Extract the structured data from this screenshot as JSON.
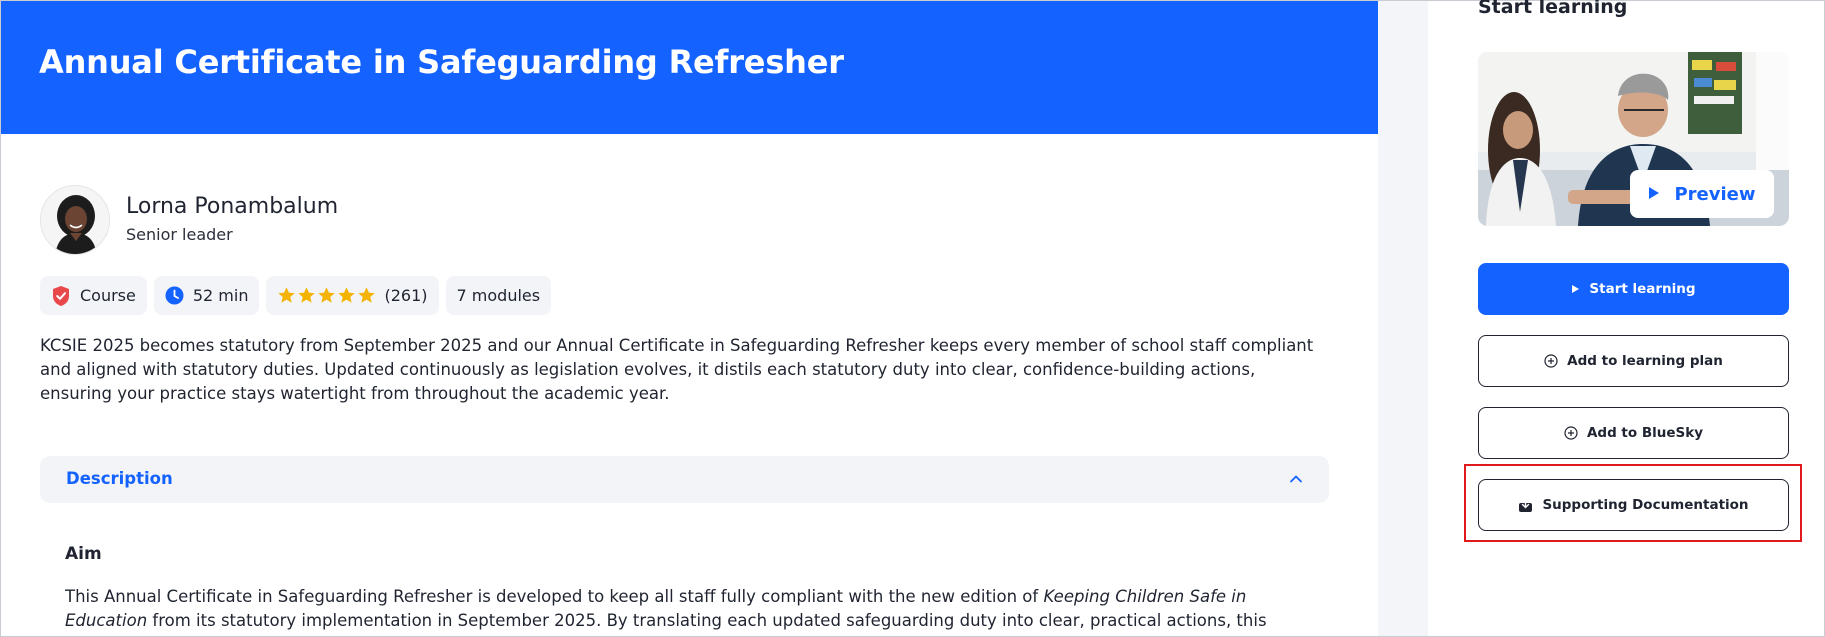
{
  "course": {
    "title": "Annual Certificate in Safeguarding Refresher",
    "author_name": "Lorna Ponambalum",
    "author_role": "Senior leader",
    "chips": {
      "type_label": "Course",
      "duration": "52 min",
      "rating_count": "(261)",
      "rating_stars": 5,
      "modules": "7 modules"
    },
    "summary": "KCSIE 2025 becomes statutory from September 2025 and our Annual Certificate in Safeguarding Refresher keeps every member of school staff compliant and aligned with statutory duties. Updated continuously as legislation evolves, it distils each statutory duty into clear, confidence-building actions, ensuring your practice stays watertight from throughout the academic year."
  },
  "description": {
    "heading": "Description",
    "aim_heading": "Aim",
    "aim_text_before": "This Annual Certificate in Safeguarding Refresher is developed to keep all staff fully compliant with the new edition of ",
    "aim_text_italic": "Keeping Children Safe in Education",
    "aim_text_after": " from its statutory implementation in September 2025. By translating each updated safeguarding duty into clear, practical actions, this course builds staff"
  },
  "sidebar": {
    "title": "Start learning",
    "preview_label": "Preview",
    "start_label": "Start learning",
    "plan_label": "Add to learning plan",
    "bluesky_label": "Add to BlueSky",
    "docs_label": "Supporting Documentation"
  },
  "colors": {
    "brand_blue": "#1462ff",
    "highlight_red": "#e0191b",
    "chip_bg": "#f2f4f8",
    "star": "#f5b301",
    "badge_red": "#e8474c"
  },
  "icons": {
    "course": "shield-check-icon",
    "duration": "clock-icon",
    "rating": "star-icon",
    "accordion": "chevron-up-icon",
    "preview": "play-icon",
    "plan": "plus-circle-icon",
    "bluesky": "plus-circle-icon",
    "docs": "download-box-icon"
  }
}
